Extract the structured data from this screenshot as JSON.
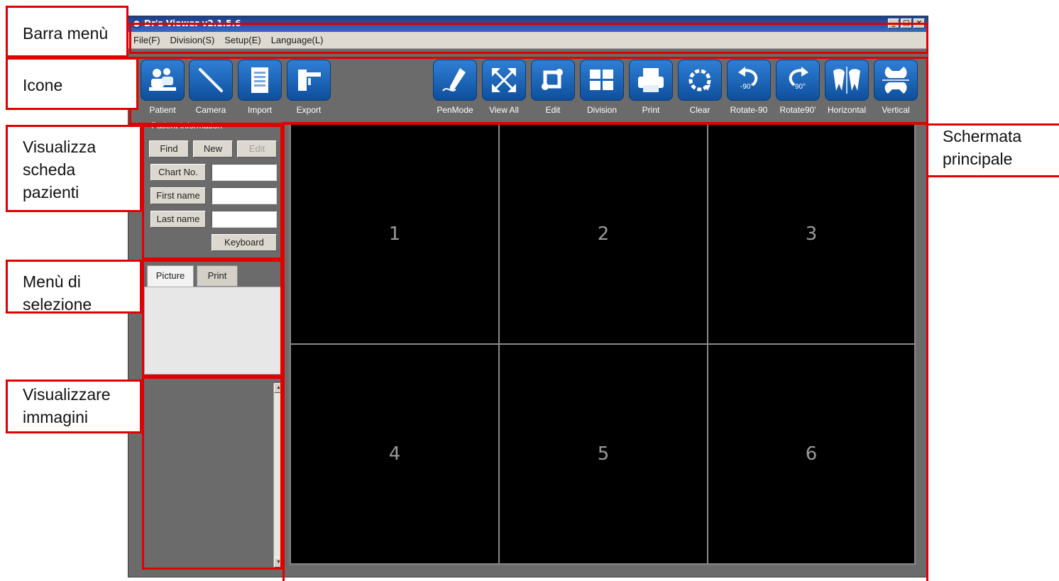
{
  "window": {
    "title": "Dr's Viewer v2.1.5.6",
    "window_buttons": [
      "_",
      "□",
      "×"
    ]
  },
  "menu": {
    "items": [
      "File(F)",
      "Division(S)",
      "Setup(E)",
      "Language(L)"
    ]
  },
  "toolbar": {
    "patient": "Patient",
    "camera": "Camera",
    "import": "Import",
    "export": "Export",
    "penmode": "PenMode",
    "viewall": "View All",
    "edit": "Edit",
    "division": "Division",
    "print": "Print",
    "clear": "Clear",
    "rotate_ccw": "Rotate-90",
    "rotate_cw": "Rotate90'",
    "horizontal": "Horizontal",
    "vertical": "Vertical",
    "rotate_ccw_glyph": "-90°",
    "rotate_cw_glyph": "90°"
  },
  "patient_panel": {
    "legend": "Patient information",
    "find": "Find",
    "new": "New",
    "edit": "Edit",
    "chart_no_label": "Chart No.",
    "first_name_label": "First name",
    "last_name_label": "Last name",
    "chart_no_value": "",
    "first_name_value": "",
    "last_name_value": "",
    "keyboard": "Keyboard"
  },
  "tabs": [
    "Picture",
    "Print"
  ],
  "grid_cells": [
    "1",
    "2",
    "3",
    "4",
    "5",
    "6"
  ],
  "annotations": {
    "menu_bar": "Barra menù",
    "icons": "Icone",
    "patient_card": [
      "Visualizza",
      "scheda",
      "pazienti"
    ],
    "selection_menu": [
      "Menù di",
      "selezione"
    ],
    "images": [
      "Visualizzare",
      "immagini"
    ],
    "main_screen": [
      "Schermata",
      "principale"
    ]
  },
  "colors": {
    "annotation_red": "#e00000",
    "window_bg": "#6b6b6b",
    "icon_blue": "#1f6fc4",
    "grid_bg": "#000000"
  }
}
